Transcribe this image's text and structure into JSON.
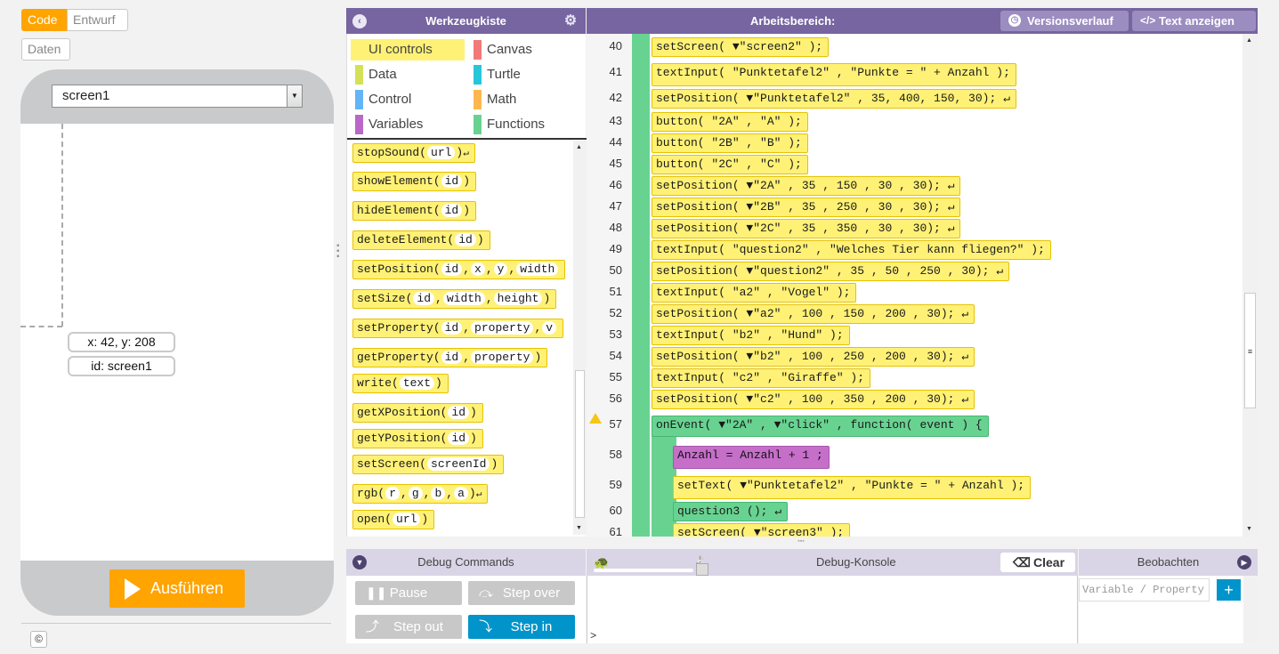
{
  "top_toggle": {
    "code": "Code",
    "design": "Entwurf",
    "data": "Daten"
  },
  "app": {
    "screen_select": "screen1",
    "coords": "x: 42, y: 208",
    "element_id": "id: screen1",
    "run": "Ausführen",
    "copyright": "©"
  },
  "toolbox": {
    "title": "Werkzeugkiste",
    "categories": [
      {
        "label": "UI controls",
        "color": "#fff176"
      },
      {
        "label": "Canvas",
        "color": "#f27979"
      },
      {
        "label": "Data",
        "color": "#d4e157"
      },
      {
        "label": "Turtle",
        "color": "#26c6da"
      },
      {
        "label": "Control",
        "color": "#64b5f6"
      },
      {
        "label": "Math",
        "color": "#ffb74d"
      },
      {
        "label": "Variables",
        "color": "#ba68c8"
      },
      {
        "label": "Functions",
        "color": "#68d391"
      }
    ],
    "blocks": [
      {
        "name": "stopSound(",
        "args": [
          "url"
        ],
        "tail": ")",
        "ret": "↵"
      },
      {
        "name": "showElement(",
        "args": [
          "id"
        ],
        "tail": ")",
        "ret": ""
      },
      {
        "name": "hideElement(",
        "args": [
          "id"
        ],
        "tail": ")",
        "ret": ""
      },
      {
        "name": "deleteElement(",
        "args": [
          "id"
        ],
        "tail": ")",
        "ret": ""
      },
      {
        "name": "setPosition(",
        "args": [
          "id",
          "x",
          "y",
          "width"
        ],
        "tail": "",
        "ret": ""
      },
      {
        "name": "setSize(",
        "args": [
          "id",
          "width",
          "height"
        ],
        "tail": ")",
        "ret": ""
      },
      {
        "name": "setProperty(",
        "args": [
          "id",
          "property",
          "v"
        ],
        "tail": "",
        "ret": ""
      },
      {
        "name": "getProperty(",
        "args": [
          "id",
          "property"
        ],
        "tail": ")",
        "ret": ""
      },
      {
        "name": "write(",
        "args": [
          "text"
        ],
        "tail": ")",
        "ret": ""
      },
      {
        "name": "getXPosition(",
        "args": [
          "id"
        ],
        "tail": ")",
        "ret": ""
      },
      {
        "name": "getYPosition(",
        "args": [
          "id"
        ],
        "tail": ")",
        "ret": ""
      },
      {
        "name": "setScreen(",
        "args": [
          "screenId"
        ],
        "tail": ")",
        "ret": ""
      },
      {
        "name": "rgb(",
        "args": [
          "r",
          "g",
          "b",
          "a"
        ],
        "tail": ")",
        "ret": "↵"
      },
      {
        "name": "open(",
        "args": [
          "url"
        ],
        "tail": ")",
        "ret": ""
      }
    ]
  },
  "workspace": {
    "title": "Arbeitsbereich:",
    "version_history": "Versionsverlauf",
    "show_text": "Text anzeigen",
    "lines": [
      {
        "n": "40",
        "code": "setScreen( ▼\"screen2\" );"
      },
      {
        "n": "41",
        "code": "textInput( \"Punktetafel2\" , \"Punkte = \" + Anzahl );"
      },
      {
        "n": "42",
        "code": "setPosition( ▼\"Punktetafel2\" , 35, 400, 150, 30); ↵"
      },
      {
        "n": "43",
        "code": "button( \"2A\" , \"A\" );"
      },
      {
        "n": "44",
        "code": "button( \"2B\" , \"B\" );"
      },
      {
        "n": "45",
        "code": "button( \"2C\" , \"C\" );"
      },
      {
        "n": "46",
        "code": "setPosition( ▼\"2A\" , 35 , 150 , 30 , 30); ↵"
      },
      {
        "n": "47",
        "code": "setPosition( ▼\"2B\" , 35 , 250 , 30 , 30); ↵"
      },
      {
        "n": "48",
        "code": "setPosition( ▼\"2C\" , 35 , 350 , 30 , 30); ↵"
      },
      {
        "n": "49",
        "code": "textInput( \"question2\" , \"Welches Tier kann fliegen?\" );"
      },
      {
        "n": "50",
        "code": "setPosition( ▼\"question2\" , 35 , 50 , 250 , 30); ↵"
      },
      {
        "n": "51",
        "code": "textInput( \"a2\" , \"Vogel\" );"
      },
      {
        "n": "52",
        "code": "setPosition( ▼\"a2\" , 100 , 150 , 200 , 30); ↵"
      },
      {
        "n": "53",
        "code": "textInput( \"b2\" , \"Hund\" );"
      },
      {
        "n": "54",
        "code": "setPosition( ▼\"b2\" , 100 , 250 , 200 , 30); ↵"
      },
      {
        "n": "55",
        "code": "textInput( \"c2\" , \"Giraffe\" );"
      },
      {
        "n": "56",
        "code": "setPosition( ▼\"c2\" , 100 , 350 , 200 , 30); ↵"
      },
      {
        "n": "57",
        "code": "onEvent( ▼\"2A\" , ▼\"click\" , function( event ) {"
      },
      {
        "n": "58",
        "code": "Anzahl = Anzahl + 1 ;"
      },
      {
        "n": "59",
        "code": "setText( ▼\"Punktetafel2\" , \"Punkte = \" + Anzahl );"
      },
      {
        "n": "60",
        "code": "question3 (); ↵"
      },
      {
        "n": "61",
        "code": "setScreen( ▼\"screen3\" );"
      }
    ]
  },
  "debug": {
    "commands_title": "Debug Commands",
    "pause": "Pause",
    "step_over": "Step over",
    "step_out": "Step out",
    "step_in": "Step in",
    "console_title": "Debug-Konsole",
    "clear": "Clear",
    "prompt": ">",
    "watch_title": "Beobachten",
    "watch_placeholder": "Variable / Property",
    "watch_add": "+"
  }
}
